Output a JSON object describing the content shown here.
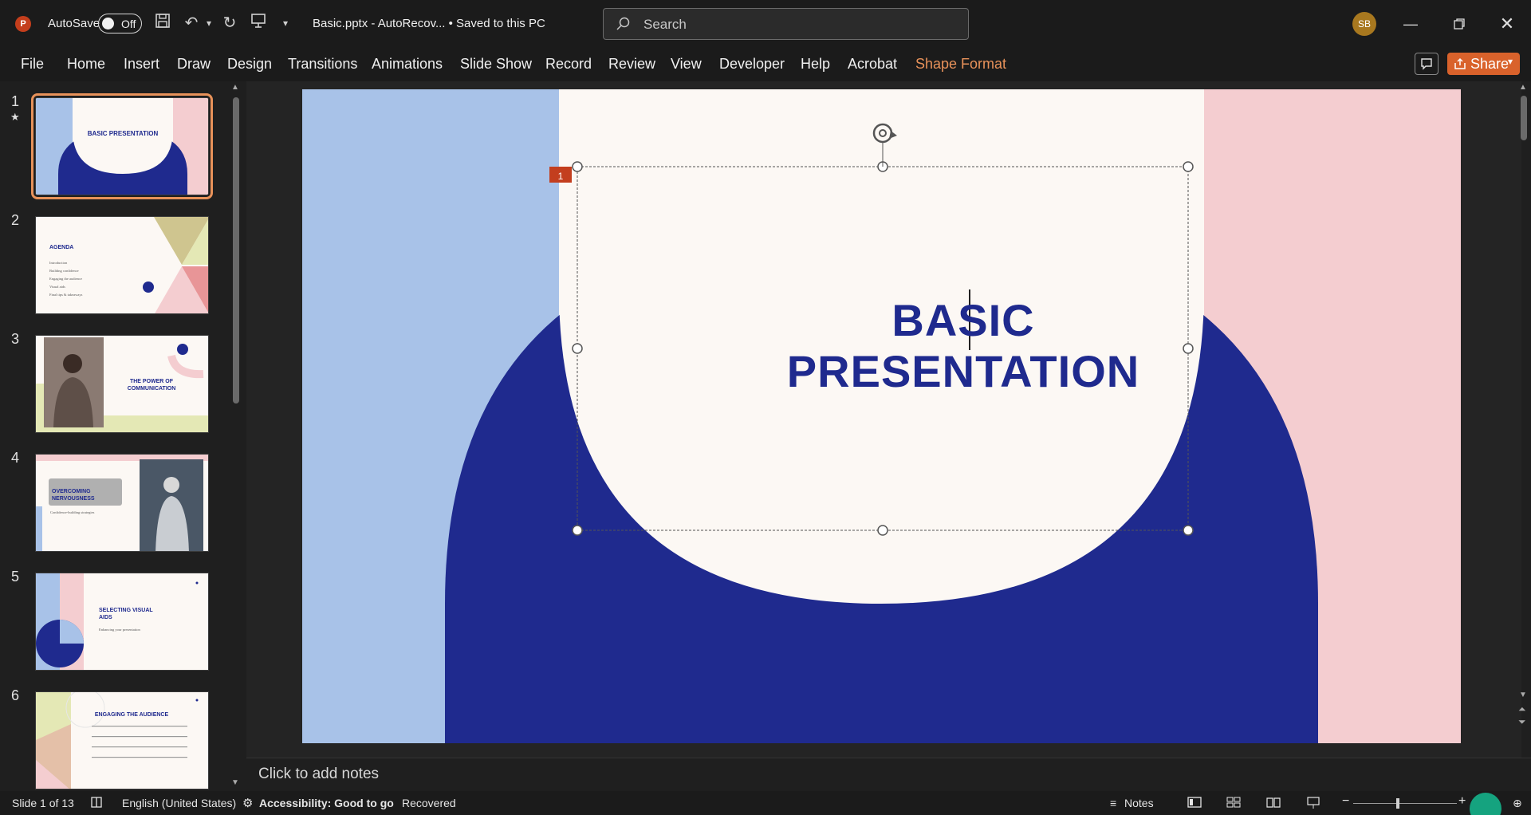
{
  "titlebar": {
    "app_logo": "P",
    "autosave_label": "AutoSave",
    "autosave_state": "Off",
    "doc_title": "Basic.pptx  -  AutoRecov...   •  Saved to this PC",
    "search_placeholder": "Search",
    "user_initials": "SB",
    "icons": [
      "save-icon",
      "undo-icon",
      "redo-icon",
      "present-icon",
      "customize-icon"
    ]
  },
  "ribbon": {
    "tabs": [
      "File",
      "Home",
      "Insert",
      "Draw",
      "Design",
      "Transitions",
      "Animations",
      "Slide Show",
      "Record",
      "Review",
      "View",
      "Developer",
      "Help",
      "Acrobat",
      "Shape Format"
    ],
    "share_label": "Share"
  },
  "thumbnails": [
    {
      "num": "1",
      "star": "★",
      "title": "BASIC PRESENTATION"
    },
    {
      "num": "2",
      "title": "AGENDA",
      "items": [
        "Introduction",
        "Building confidence",
        "Engaging the audience",
        "Visual aids",
        "Final tips & takeaways"
      ]
    },
    {
      "num": "3",
      "title": "THE POWER OF COMMUNICATION"
    },
    {
      "num": "4",
      "title": "OVERCOMING NERVOUSNESS",
      "subtitle": "Confidence-building strategies"
    },
    {
      "num": "5",
      "title": "SELECTING VISUAL AIDS",
      "subtitle": "Enhancing your presentation"
    },
    {
      "num": "6",
      "title": "ENGAGING THE AUDIENCE"
    }
  ],
  "slide": {
    "title_line1": "BASIC",
    "title_line2": "PRESENTATION",
    "animation_tag": "1",
    "colors": {
      "blue": "#a8c2e8",
      "pink": "#f4cdd0",
      "navy": "#1f2a8e",
      "cream": "#fcf8f4"
    }
  },
  "notes_placeholder": "Click to add notes",
  "status": {
    "slide_counter": "Slide 1 of 13",
    "language": "English (United States)",
    "accessibility": "Accessibility: Good to go",
    "recovered": "Recovered",
    "notes_label": "Notes"
  }
}
